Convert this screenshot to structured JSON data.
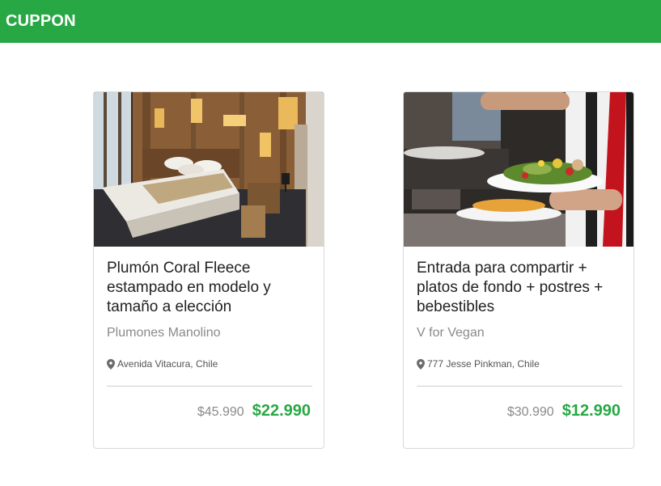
{
  "header": {
    "brand": "CUPPON",
    "color": "#27a844"
  },
  "cards": [
    {
      "image": "hotel-bedroom-photo",
      "title": "Plumón Coral Fleece estampado en modelo y tamaño a elección",
      "vendor": "Plumones Manolino",
      "location": "Avenida Vitacura, Chile",
      "old_price": "$45.990",
      "new_price": "$22.990"
    },
    {
      "image": "waiter-serving-salad-photo",
      "title": "Entrada para compartir + platos de fondo + postres + bebestibles",
      "vendor": "V for Vegan",
      "location": "777 Jesse Pinkman, Chile",
      "old_price": "$30.990",
      "new_price": "$12.990"
    }
  ]
}
